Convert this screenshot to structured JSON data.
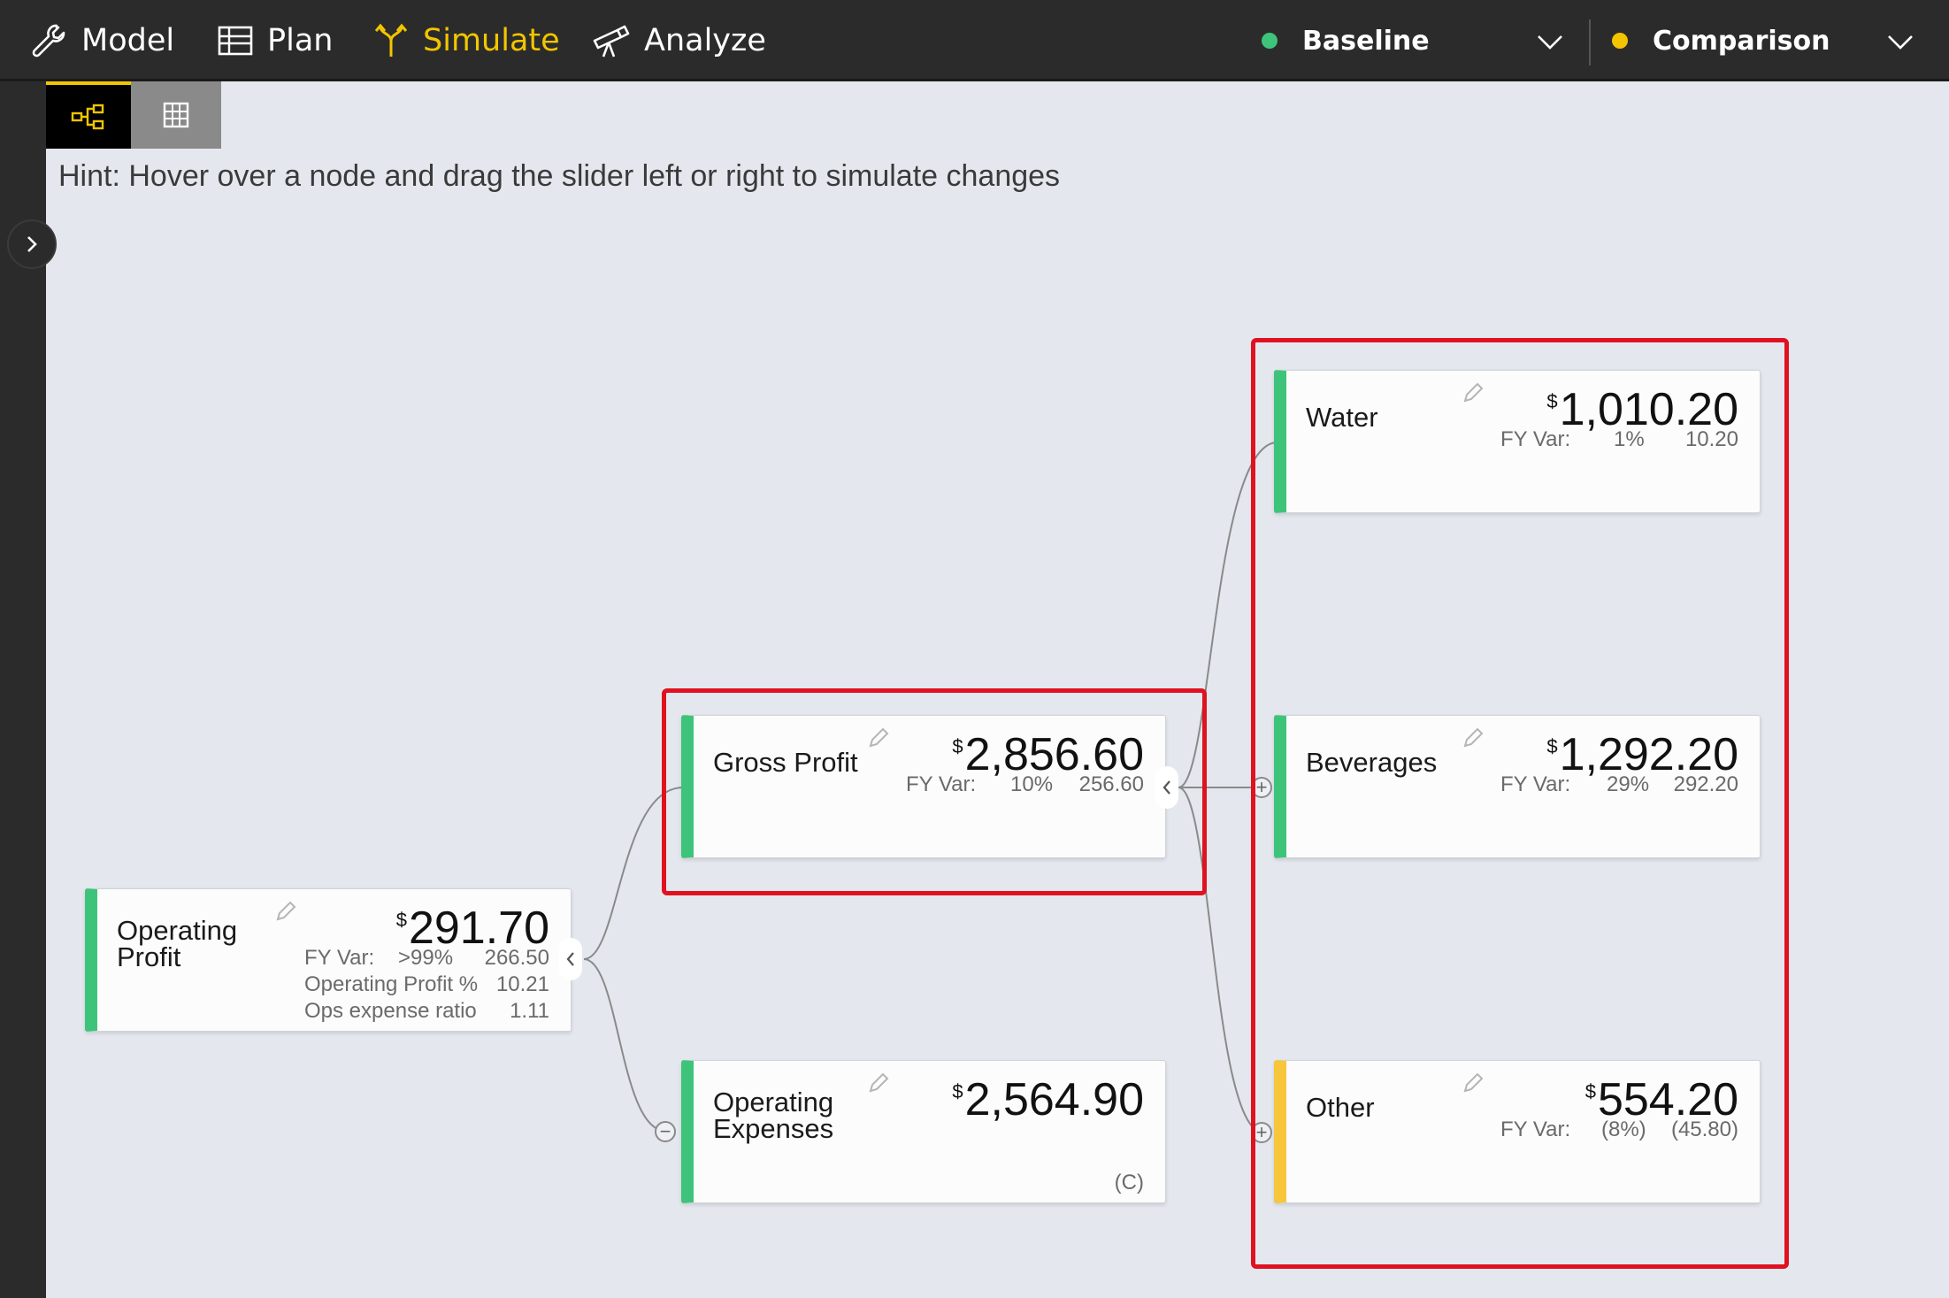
{
  "nav": {
    "model": "Model",
    "plan": "Plan",
    "simulate": "Simulate",
    "analyze": "Analyze",
    "active": "simulate"
  },
  "scenarios": {
    "baseline": {
      "label": "Baseline",
      "color": "#3ec47a"
    },
    "comparison": {
      "label": "Comparison",
      "color": "#f2c500"
    }
  },
  "hint": "Hint: Hover over a node and drag the slider left or right to simulate changes",
  "nodes": {
    "operating_profit": {
      "label_line1": "Operating",
      "label_line2": "Profit",
      "currency": "$",
      "value": "291.70",
      "metrics": [
        {
          "name": "FY Var:",
          "pct": ">99%",
          "val": "266.50"
        },
        {
          "name": "Operating Profit %",
          "val": "10.21"
        },
        {
          "name": "Ops expense ratio",
          "val": "1.11"
        }
      ],
      "status_color": "#3ec47a"
    },
    "gross_profit": {
      "label": "Gross Profit",
      "currency": "$",
      "value": "2,856.60",
      "fy_label": "FY Var:",
      "fy_pct": "10%",
      "fy_val": "256.60",
      "status_color": "#3ec47a"
    },
    "operating_expenses": {
      "label_line1": "Operating",
      "label_line2": "Expenses",
      "currency": "$",
      "value": "2,564.90",
      "tag": "(C)",
      "status_color": "#3ec47a"
    },
    "water": {
      "label": "Water",
      "currency": "$",
      "value": "1,010.20",
      "fy_label": "FY Var:",
      "fy_pct": "1%",
      "fy_val": "10.20",
      "status_color": "#3ec47a"
    },
    "beverages": {
      "label": "Beverages",
      "currency": "$",
      "value": "1,292.20",
      "fy_label": "FY Var:",
      "fy_pct": "29%",
      "fy_val": "292.20",
      "status_color": "#3ec47a"
    },
    "other": {
      "label": "Other",
      "currency": "$",
      "value": "554.20",
      "fy_label": "FY Var:",
      "fy_pct": "(8%)",
      "fy_val": "(45.80)",
      "status_color": "#f7c63a"
    }
  },
  "highlight_color": "#e0121f"
}
